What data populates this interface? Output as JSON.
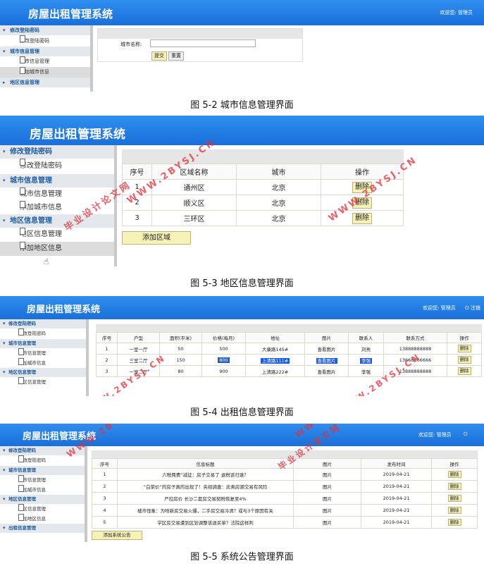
{
  "app_title": "房屋出租管理系统",
  "welcome": "欢迎您:  管理员",
  "logout": "注销",
  "menu": {
    "change_password": "修改登陆密码",
    "change_password_item": "修改登陆密码",
    "city_mgmt": "城市信息管理",
    "city_item": "城市信息管理",
    "add_city": "添加城市信息",
    "district_mgmt": "地区信息管理",
    "district_item": "地区信息管理",
    "add_district": "添加地区信息",
    "rental_mgmt": "出租信息管理"
  },
  "fig52": {
    "city_label": "城市名称:",
    "submit": "提交",
    "reset": "重置",
    "caption": "图 5-2 城市信息管理界面"
  },
  "fig53": {
    "headers": [
      "序号",
      "区域名称",
      "城市",
      "操作"
    ],
    "rows": [
      {
        "no": "1",
        "name": "通州区",
        "city": "北京",
        "op": "删除"
      },
      {
        "no": "2",
        "name": "顺义区",
        "city": "北京",
        "op": "删除"
      },
      {
        "no": "3",
        "name": "三环区",
        "city": "北京",
        "op": "删除"
      }
    ],
    "add_button": "添加区域",
    "caption": "图 5-3  地区信息管理界面"
  },
  "fig54": {
    "headers": [
      "序号",
      "户型",
      "面积(平米)",
      "价格(每月)",
      "地址",
      "图片",
      "联系人",
      "联系方式",
      "操作"
    ],
    "rows": [
      {
        "no": "1",
        "type": "一室一厅",
        "area": "50",
        "price": "500",
        "addr": "大康路145#",
        "pic": "查看图片",
        "contact": "刘亮",
        "phone": "13888888888",
        "op": "删除"
      },
      {
        "no": "2",
        "type": "三室二厅",
        "area": "150",
        "price": "800",
        "addr": "上清路111#",
        "pic": "查看图片",
        "contact": "李强",
        "phone": "13666666666",
        "op": "删除"
      },
      {
        "no": "3",
        "type": "一室二厅",
        "area": "80",
        "price": "900",
        "addr": "上清路222#",
        "pic": "查看图片",
        "contact": "李强",
        "phone": "13888888888",
        "op": "删除"
      }
    ],
    "caption": "图 5-4  出租信息管理界面"
  },
  "fig55": {
    "headers": [
      "序号",
      "信息标题",
      "图片",
      "发布时间",
      "操作"
    ],
    "rows": [
      {
        "no": "1",
        "title": "六税两费”减征：房子交易了 退税该归谁？",
        "pic": "图片",
        "date": "2019-04-21",
        "op": "删除"
      },
      {
        "no": "2",
        "title": "“白菜价”的房子真的出现了！央视调查：此类房源交易有风险",
        "pic": "图片",
        "date": "2019-04-21",
        "op": "删除"
      },
      {
        "no": "3",
        "title": "严控房价 长沙二套房交易契税恢复至4%",
        "pic": "图片",
        "date": "2019-04-21",
        "op": "删除"
      },
      {
        "no": "4",
        "title": "楼市怪象：为啥新房交易火爆，二手房交易冷清？或与3个原因有关",
        "pic": "图片",
        "date": "2019-04-21",
        "op": "删除"
      },
      {
        "no": "5",
        "title": "学区房交易遭到区划调整该退买单？法院这样判",
        "pic": "图片",
        "date": "2019-04-21",
        "op": "删除"
      }
    ],
    "add_button": "添加系统公告",
    "caption": "图 5-5 系统公告管理界面"
  },
  "watermark": {
    "site": "WWW.2BYSJ.CN",
    "cn": "毕业设计论文网"
  }
}
